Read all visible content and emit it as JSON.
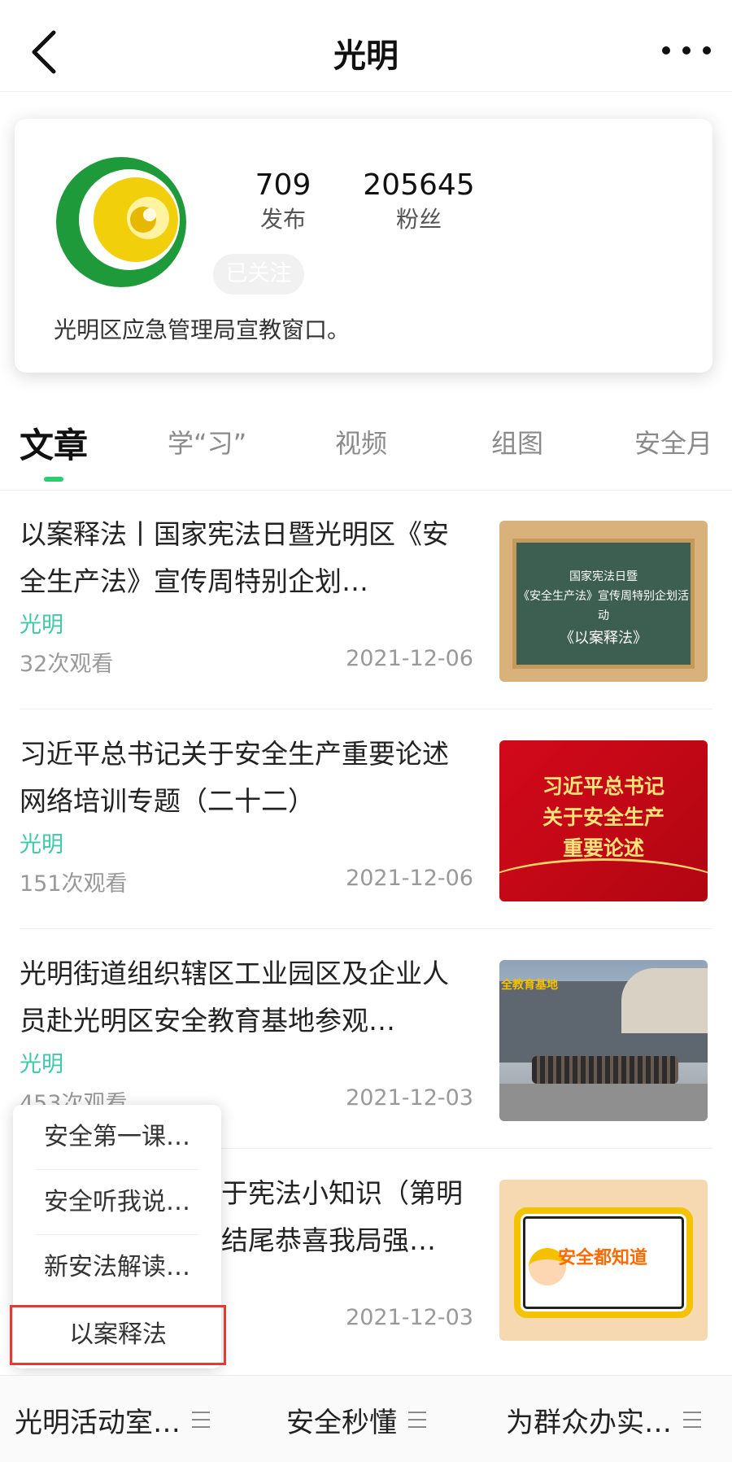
{
  "header": {
    "title": "光明"
  },
  "profile": {
    "posts_count": "709",
    "posts_label": "发布",
    "fans_count": "205645",
    "fans_label": "粉丝",
    "follow_label": "已关注",
    "bio": "光明区应急管理局宣教窗口。"
  },
  "tabs": [
    {
      "label": "文章"
    },
    {
      "label": "学“习”"
    },
    {
      "label": "视频"
    },
    {
      "label": "组图"
    },
    {
      "label": "安全月"
    }
  ],
  "articles": [
    {
      "title": "以案释法丨国家宪法日暨光明区《安全生产法》宣传周特别企划…",
      "source": "光明",
      "views": "32次观看",
      "date": "2021-12-06",
      "thumb_lines": [
        "国家宪法日暨",
        "《安全生产法》宣传周特别企划活动",
        "《以案释法》"
      ]
    },
    {
      "title": "习近平总书记关于安全生产重要论述网络培训专题（二十二）",
      "source": "光明",
      "views": "151次观看",
      "date": "2021-12-06",
      "thumb_lines": [
        "习近平总书记",
        "关于安全生产",
        "重要论述"
      ]
    },
    {
      "title": "光明街道组织辖区工业园区及企业人员赴光明区安全教育基地参观…",
      "source": "光明",
      "views": "453次观看",
      "date": "2021-12-03",
      "thumb_lines": [
        "全教育基地"
      ]
    },
    {
      "title": "于宪法小知识（第明结尾恭喜我局强…",
      "source": "",
      "views": "",
      "date": "2021-12-03",
      "thumb_lines": [
        "安全都知道"
      ]
    }
  ],
  "popup_menu": [
    {
      "label": "安全第一课…"
    },
    {
      "label": "安全听我说…"
    },
    {
      "label": "新安法解读…"
    },
    {
      "label": "以案释法"
    }
  ],
  "bottom_bar": [
    {
      "label": "光明活动室…"
    },
    {
      "label": "安全秒懂"
    },
    {
      "label": "为群众办实…"
    }
  ],
  "colors": {
    "accent_green": "#2ecc71",
    "source_teal": "#3fc9a8",
    "highlight_red": "#e53935"
  }
}
